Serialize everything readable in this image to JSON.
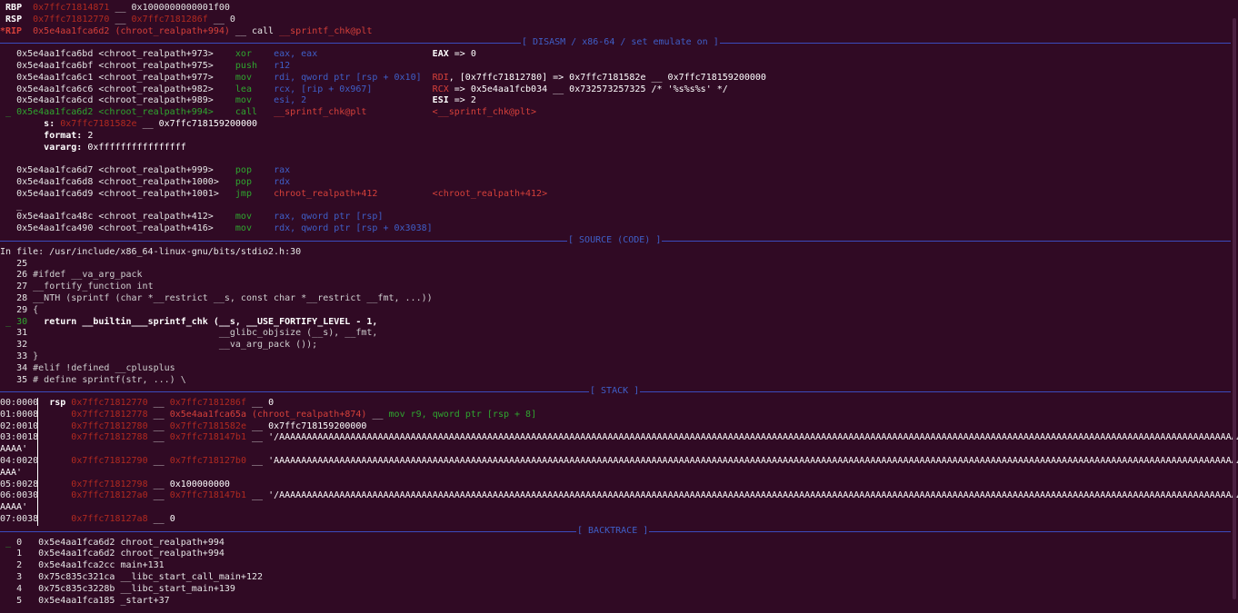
{
  "registers": {
    "rbp": {
      "name": "RBP",
      "addr": "0x7ffc71814871",
      "sep": " __ ",
      "val": "0x1000000000001f00"
    },
    "rsp": {
      "name": "RSP",
      "addr": "0x7ffc71812770",
      "sep": " __ ",
      "ptr": "0x7ffc7181286f",
      "sep2": " __ ",
      "val": "0"
    },
    "rip": {
      "name": "*RIP",
      "addr": "0x5e4aa1fca6d2",
      "sym": "(chroot_realpath+994)",
      "sep": " __ ",
      "ins": "call",
      "target": "__sprintf_chk@plt"
    }
  },
  "sections": {
    "disasm": "[ DISASM / x86-64 / set emulate on ]",
    "source": "[ SOURCE (CODE) ]",
    "stack": "[ STACK ]",
    "backtrace": "[ BACKTRACE ]"
  },
  "disasm": [
    {
      "marker": "",
      "addr": "0x5e4aa1fca6bd",
      "sym": "<chroot_realpath+973>",
      "mn": "xor",
      "ops": "eax, eax",
      "cmt_reg": "EAX",
      "cmt": " => 0"
    },
    {
      "marker": "",
      "addr": "0x5e4aa1fca6bf",
      "sym": "<chroot_realpath+975>",
      "mn": "push",
      "ops": "r12",
      "cmt_reg": "",
      "cmt": ""
    },
    {
      "marker": "",
      "addr": "0x5e4aa1fca6c1",
      "sym": "<chroot_realpath+977>",
      "mn": "mov",
      "ops": "rdi, qword ptr [rsp + 0x10]",
      "cmt_reg": "RDI",
      "cmt": ", [0x7ffc71812780] => 0x7ffc7181582e __ 0x7ffc718159200000"
    },
    {
      "marker": "",
      "addr": "0x5e4aa1fca6c6",
      "sym": "<chroot_realpath+982>",
      "mn": "lea",
      "ops": "rcx, [rip + 0x967]",
      "cmt_reg": "RCX",
      "cmt": " => 0x5e4aa1fcb034 __ 0x732573257325 /* '%s%s%s' */"
    },
    {
      "marker": "",
      "addr": "0x5e4aa1fca6cd",
      "sym": "<chroot_realpath+989>",
      "mn": "mov",
      "ops": "esi, 2",
      "cmt_reg": "ESI",
      "cmt": " => 2"
    },
    {
      "marker": "_",
      "addr": "0x5e4aa1fca6d2",
      "sym": "<chroot_realpath+994>",
      "mn": "call",
      "ops": "__sprintf_chk@plt",
      "cmt_reg": "",
      "cmt": "<__sprintf_chk@plt>"
    }
  ],
  "call_args": [
    {
      "name": "s:",
      "addr": "0x7ffc7181582e",
      "sep": " __ ",
      "val": "0x7ffc718159200000"
    },
    {
      "name": "format:",
      "addr": "",
      "sep": "",
      "val": "2"
    },
    {
      "name": "vararg:",
      "addr": "",
      "sep": "",
      "val": "0xffffffffffffffff"
    }
  ],
  "disasm2": [
    {
      "addr": "0x5e4aa1fca6d7",
      "sym": "<chroot_realpath+999>",
      "mn": "pop",
      "ops": "rax",
      "tgt": ""
    },
    {
      "addr": "0x5e4aa1fca6d8",
      "sym": "<chroot_realpath+1000>",
      "mn": "pop",
      "ops": "rdx",
      "tgt": ""
    },
    {
      "addr": "0x5e4aa1fca6d9",
      "sym": "<chroot_realpath+1001>",
      "mn": "jmp",
      "ops": "chroot_realpath+412",
      "tgt": "<chroot_realpath+412>"
    }
  ],
  "disasm3": [
    {
      "addr": "0x5e4aa1fca48c",
      "sym": "<chroot_realpath+412>",
      "mn": "mov",
      "ops": "rax, qword ptr [rsp]"
    },
    {
      "addr": "0x5e4aa1fca490",
      "sym": "<chroot_realpath+416>",
      "mn": "mov",
      "ops": "rdx, qword ptr [rsp + 0x3038]"
    }
  ],
  "source": {
    "file_label": "In file: /usr/include/x86_64-linux-gnu/bits/stdio2.h:30",
    "lines": [
      {
        "n": "25",
        "marker": "",
        "text": ""
      },
      {
        "n": "26",
        "marker": "",
        "text": "#ifdef __va_arg_pack"
      },
      {
        "n": "27",
        "marker": "",
        "text": "__fortify_function int"
      },
      {
        "n": "28",
        "marker": "",
        "text": "__NTH (sprintf (char *__restrict __s, const char *__restrict __fmt, ...))"
      },
      {
        "n": "29",
        "marker": "",
        "text": "{"
      },
      {
        "n": "30",
        "marker": "_",
        "text": "  return __builtin___sprintf_chk (__s, __USE_FORTIFY_LEVEL - 1,"
      },
      {
        "n": "31",
        "marker": "",
        "text": "                                  __glibc_objsize (__s), __fmt,"
      },
      {
        "n": "32",
        "marker": "",
        "text": "                                  __va_arg_pack ());"
      },
      {
        "n": "33",
        "marker": "",
        "text": "}"
      },
      {
        "n": "34",
        "marker": "",
        "text": "#elif !defined __cplusplus"
      },
      {
        "n": "35",
        "marker": "",
        "text": "# define sprintf(str, ...) \\"
      }
    ]
  },
  "stack": [
    {
      "idx": "00:0000",
      "reg": "rsp",
      "addr": "0x7ffc71812770",
      "sep": " __ ",
      "ptr": "0x7ffc7181286f",
      "sep2": " __ ",
      "val": "0",
      "extra": ""
    },
    {
      "idx": "01:0008",
      "reg": "",
      "addr": "0x7ffc71812778",
      "sep": " __ ",
      "ptr": "0x5e4aa1fca65a (chroot_realpath+874)",
      "sep2": " __ ",
      "val": "mov r9, qword ptr [rsp + 8]",
      "extra": ""
    },
    {
      "idx": "02:0010",
      "reg": "",
      "addr": "0x7ffc71812780",
      "sep": " __ ",
      "ptr": "0x7ffc7181582e",
      "sep2": " __ ",
      "val": "0x7ffc718159200000",
      "extra": ""
    },
    {
      "idx": "03:0018",
      "reg": "",
      "addr": "0x7ffc71812788",
      "sep": " __ ",
      "ptr": "0x7ffc718147b1",
      "sep2": " __ ",
      "val": "'/AAAAAAAAAAAAAAAAAAAAAAAAAAAAAAAAAAAAAAAAAAAAAAAAAAAAAAAAAAAAAAAAAAAAAAAAAAAAAAAAAAAAAAAAAAAAAAAAAAAAAAAAAAAAAAAAAAAAAAAAAAAAAAAAAAAAAAAAAAAAAAAAAAAAAAAAAAAAAAAAAAAAAAAAAAAAAAAAAAAAAAAAA",
      "extra": "AAAA'"
    },
    {
      "idx": "04:0020",
      "reg": "",
      "addr": "0x7ffc71812790",
      "sep": " __ ",
      "ptr": "0x7ffc718127b0",
      "sep2": " __ ",
      "val": "'AAAAAAAAAAAAAAAAAAAAAAAAAAAAAAAAAAAAAAAAAAAAAAAAAAAAAAAAAAAAAAAAAAAAAAAAAAAAAAAAAAAAAAAAAAAAAAAAAAAAAAAAAAAAAAAAAAAAAAAAAAAAAAAAAAAAAAAAAAAAAAAAAAAAAAAAAAAAAAAAAAAAAAAAAAAAAAAAAAAAAAAAA",
      "extra": "AAA'"
    },
    {
      "idx": "05:0028",
      "reg": "",
      "addr": "0x7ffc71812798",
      "sep": " __ ",
      "ptr": "0x100000000",
      "sep2": "",
      "val": "",
      "extra": ""
    },
    {
      "idx": "06:0030",
      "reg": "",
      "addr": "0x7ffc718127a0",
      "sep": " __ ",
      "ptr": "0x7ffc718147b1",
      "sep2": " __ ",
      "val": "'/AAAAAAAAAAAAAAAAAAAAAAAAAAAAAAAAAAAAAAAAAAAAAAAAAAAAAAAAAAAAAAAAAAAAAAAAAAAAAAAAAAAAAAAAAAAAAAAAAAAAAAAAAAAAAAAAAAAAAAAAAAAAAAAAAAAAAAAAAAAAAAAAAAAAAAAAAAAAAAAAAAAAAAAAAAAAAAAAAAAAAAAAA",
      "extra": "AAAA'"
    },
    {
      "idx": "07:0038",
      "reg": "",
      "addr": "0x7ffc718127a8",
      "sep": " __ ",
      "ptr": "0",
      "sep2": "",
      "val": "",
      "extra": ""
    }
  ],
  "backtrace": [
    {
      "marker": "_",
      "n": "0",
      "addr": "0x5e4aa1fca6d2",
      "fn": "chroot_realpath+994"
    },
    {
      "marker": "",
      "n": "1",
      "addr": "0x5e4aa1fca6d2",
      "fn": "chroot_realpath+994"
    },
    {
      "marker": "",
      "n": "2",
      "addr": "0x5e4aa1fca2cc",
      "fn": "main+131"
    },
    {
      "marker": "",
      "n": "3",
      "addr": "0x75c835c321ca",
      "fn": "__libc_start_call_main+122"
    },
    {
      "marker": "",
      "n": "4",
      "addr": "0x75c835c3228b",
      "fn": "__libc_start_main+139"
    },
    {
      "marker": "",
      "n": "5",
      "addr": "0x5e4aa1fca185",
      "fn": "_start+37"
    }
  ]
}
